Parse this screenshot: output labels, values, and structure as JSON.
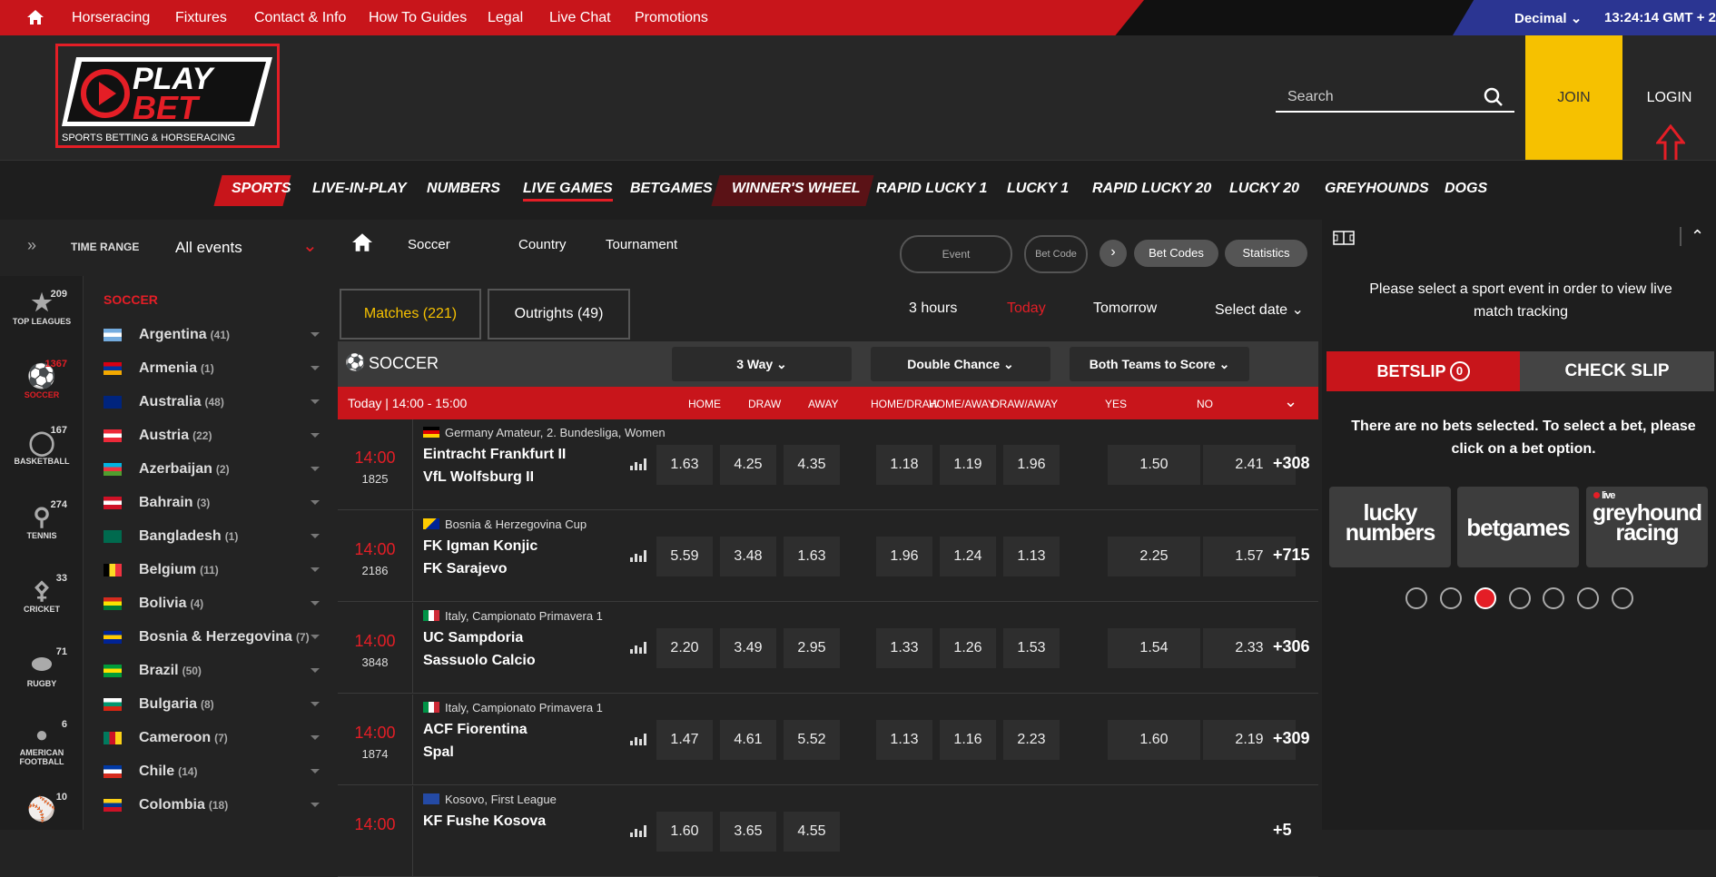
{
  "topnav": {
    "items": [
      "Horseracing",
      "Fixtures",
      "Contact & Info",
      "How To Guides",
      "Legal",
      "Live Chat",
      "Promotions"
    ],
    "odds_format": "Decimal",
    "clock": "13:24:14 GMT + 2"
  },
  "header": {
    "logo_top": "PLAY",
    "logo_bottom": "BET",
    "logo_tagline": "SPORTS BETTING & HORSERACING",
    "search_placeholder": "Search",
    "join": "JOIN",
    "login": "LOGIN"
  },
  "sportsnav": [
    "SPORTS",
    "LIVE-IN-PLAY",
    "NUMBERS",
    "LIVE GAMES",
    "BETGAMES",
    "WINNER'S WHEEL",
    "RAPID LUCKY 1",
    "LUCKY 1",
    "RAPID LUCKY 20",
    "LUCKY 20",
    "GREYHOUNDS",
    "DOGS"
  ],
  "filter": {
    "time_range_label": "TIME RANGE",
    "time_range_value": "All events"
  },
  "rail": [
    {
      "label": "TOP LEAGUES",
      "count": "209"
    },
    {
      "label": "SOCCER",
      "count": "1367"
    },
    {
      "label": "BASKETBALL",
      "count": "167"
    },
    {
      "label": "TENNIS",
      "count": "274"
    },
    {
      "label": "CRICKET",
      "count": "33"
    },
    {
      "label": "RUGBY",
      "count": "71"
    },
    {
      "label": "AMERICAN FOOTBALL",
      "count": "6"
    },
    {
      "label": "",
      "count": "10"
    }
  ],
  "countries_heading": "SOCCER",
  "countries": [
    {
      "name": "Argentina",
      "count": "(41)"
    },
    {
      "name": "Armenia",
      "count": "(1)"
    },
    {
      "name": "Australia",
      "count": "(48)"
    },
    {
      "name": "Austria",
      "count": "(22)"
    },
    {
      "name": "Azerbaijan",
      "count": "(2)"
    },
    {
      "name": "Bahrain",
      "count": "(3)"
    },
    {
      "name": "Bangladesh",
      "count": "(1)"
    },
    {
      "name": "Belgium",
      "count": "(11)"
    },
    {
      "name": "Bolivia",
      "count": "(4)"
    },
    {
      "name": "Bosnia & Herzegovina",
      "count": "(7)"
    },
    {
      "name": "Brazil",
      "count": "(50)"
    },
    {
      "name": "Bulgaria",
      "count": "(8)"
    },
    {
      "name": "Cameroon",
      "count": "(7)"
    },
    {
      "name": "Chile",
      "count": "(14)"
    },
    {
      "name": "Colombia",
      "count": "(18)"
    }
  ],
  "breadcrumb": {
    "soccer": "Soccer",
    "country": "Country",
    "tournament": "Tournament"
  },
  "event_input": "Event",
  "betcode_input": "Bet Code",
  "bet_codes": "Bet Codes",
  "statistics": "Statistics",
  "tabs": {
    "matches": "Matches (221)",
    "outrights": "Outrights (49)"
  },
  "time_filters": [
    "3 hours",
    "Today",
    "Tomorrow",
    "Select date"
  ],
  "section": {
    "title": "SOCCER",
    "markets": [
      "3 Way",
      "Double Chance",
      "Both Teams to Score"
    ]
  },
  "timebar": {
    "label": "Today | 14:00 - 15:00",
    "cols": [
      "HOME",
      "DRAW",
      "AWAY",
      "HOME/DRAW",
      "HOME/AWAY",
      "DRAW/AWAY",
      "YES",
      "NO"
    ]
  },
  "matches": [
    {
      "time": "14:00",
      "id": "1825",
      "league": "Germany Amateur, 2. Bundesliga, Women",
      "home": "Eintracht Frankfurt II",
      "away": "VfL Wolfsburg II",
      "odds": [
        "1.63",
        "4.25",
        "4.35",
        "1.18",
        "1.19",
        "1.96",
        "1.50",
        "2.41"
      ],
      "more": "+308"
    },
    {
      "time": "14:00",
      "id": "2186",
      "league": "Bosnia & Herzegovina Cup",
      "home": "FK Igman Konjic",
      "away": "FK Sarajevo",
      "odds": [
        "5.59",
        "3.48",
        "1.63",
        "1.96",
        "1.24",
        "1.13",
        "2.25",
        "1.57"
      ],
      "more": "+715"
    },
    {
      "time": "14:00",
      "id": "3848",
      "league": "Italy, Campionato Primavera 1",
      "home": "UC Sampdoria",
      "away": "Sassuolo Calcio",
      "odds": [
        "2.20",
        "3.49",
        "2.95",
        "1.33",
        "1.26",
        "1.53",
        "1.54",
        "2.33"
      ],
      "more": "+306"
    },
    {
      "time": "14:00",
      "id": "1874",
      "league": "Italy, Campionato Primavera 1",
      "home": "ACF Fiorentina",
      "away": "Spal",
      "odds": [
        "1.47",
        "4.61",
        "5.52",
        "1.13",
        "1.16",
        "2.23",
        "1.60",
        "2.19"
      ],
      "more": "+309"
    },
    {
      "time": "14:00",
      "id": "",
      "league": "Kosovo, First League",
      "home": "KF Fushe Kosova",
      "away": "",
      "odds": [
        "1.60",
        "3.65",
        "4.55",
        "",
        "",
        "",
        "",
        ""
      ],
      "more": "+5"
    }
  ],
  "tracker_text": "Please select a sport event in order to view live match tracking",
  "betslip": {
    "label": "BETSLIP",
    "count": "0",
    "check": "CHECK SLIP",
    "empty": "There are no bets selected. To select a bet, please click on a bet option."
  },
  "promos": [
    {
      "line1": "lucky",
      "line2": "numbers"
    },
    {
      "line1": "betgames",
      "line2": ""
    },
    {
      "line1": "greyhound",
      "line2": "racing",
      "tag": "live"
    }
  ],
  "colors": {
    "red": "#c8151b",
    "yellow": "#f6c100",
    "blue": "#2b3592"
  }
}
